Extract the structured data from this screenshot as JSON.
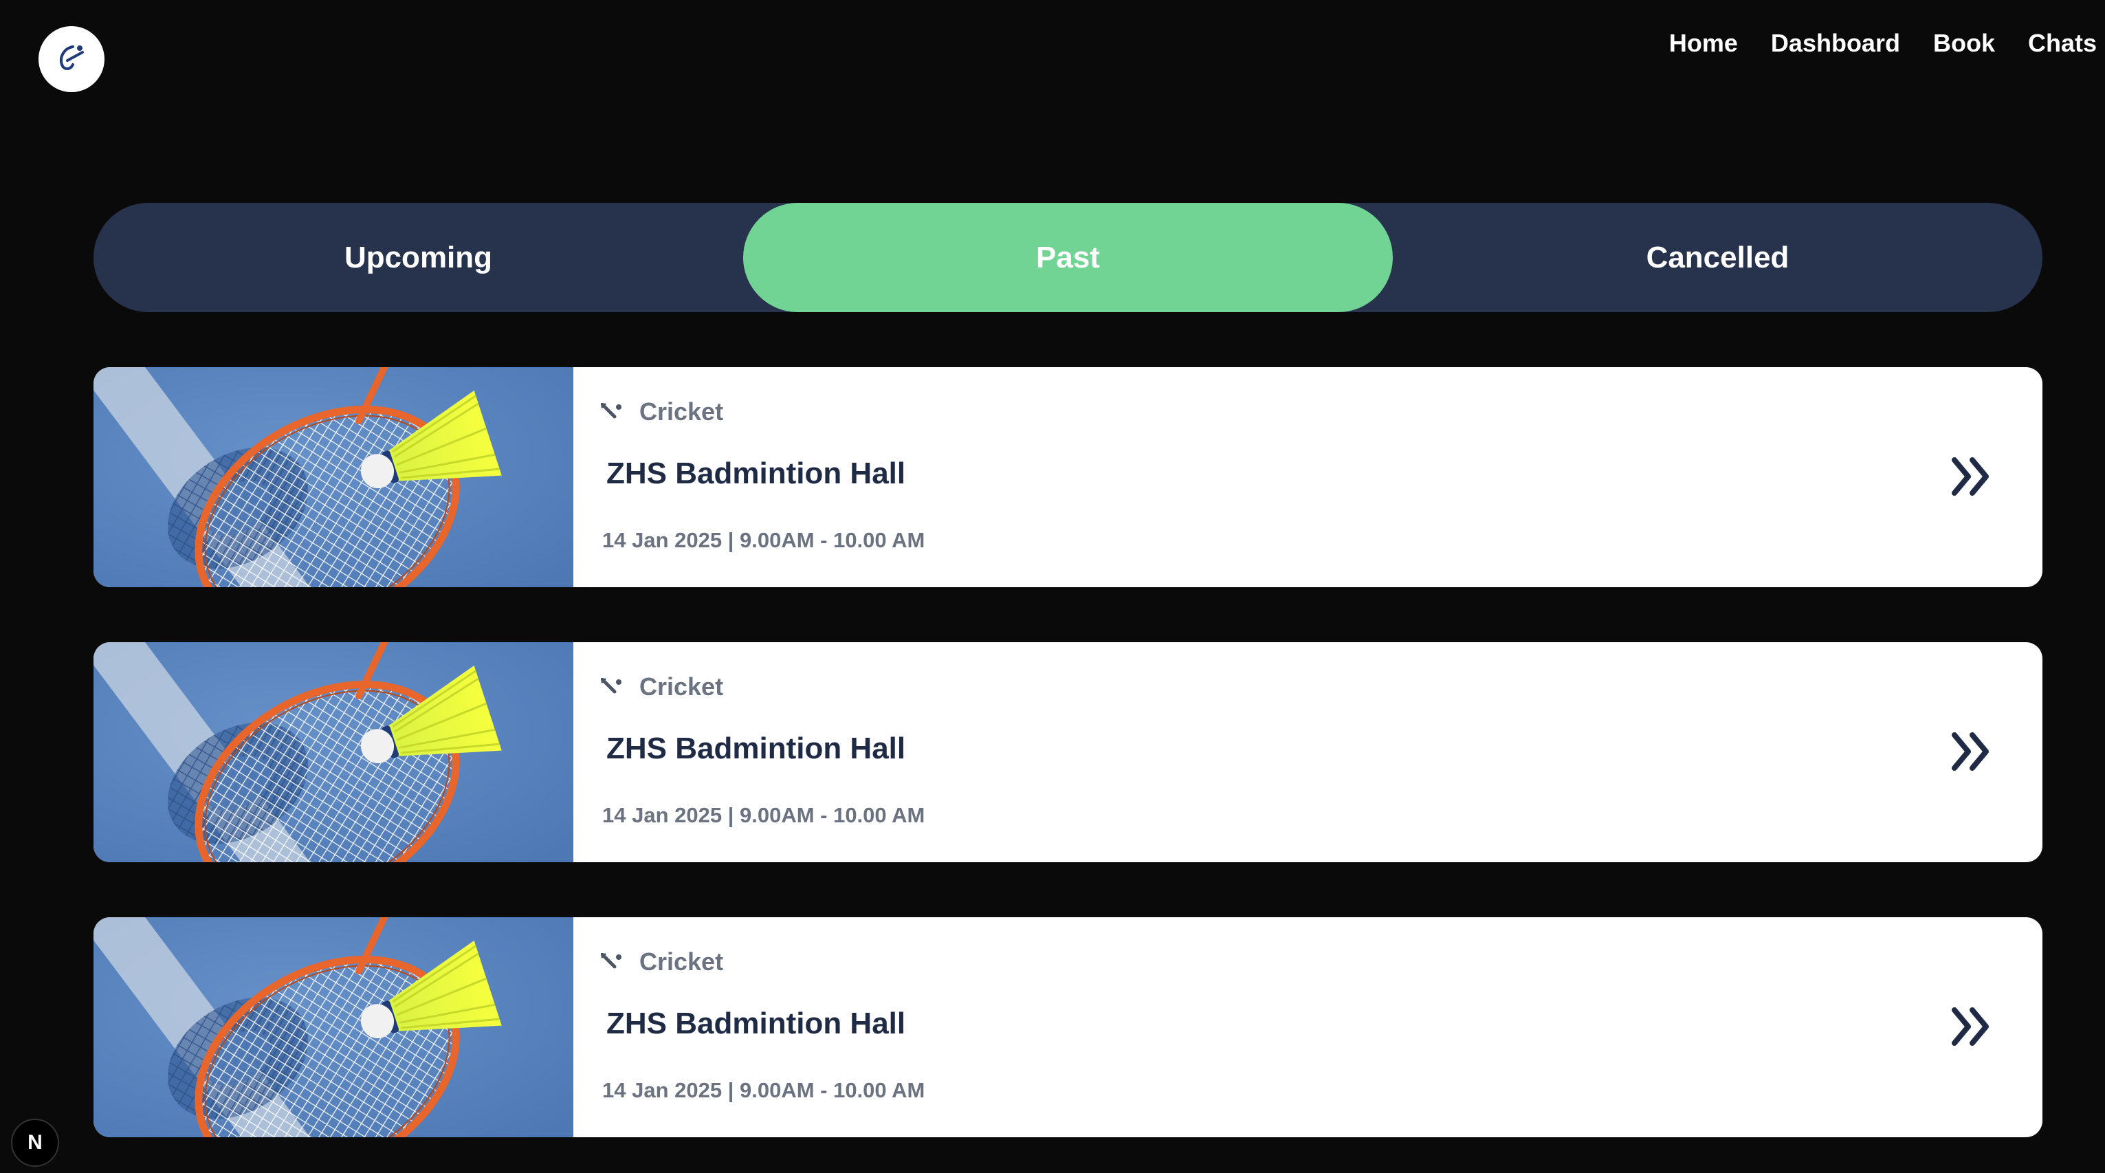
{
  "header": {
    "logo_icon": "brand-logo-icon",
    "nav": [
      {
        "label": "Home"
      },
      {
        "label": "Dashboard"
      },
      {
        "label": "Book"
      },
      {
        "label": "Chats"
      }
    ]
  },
  "tabs": [
    {
      "label": "Upcoming",
      "active": false
    },
    {
      "label": "Past",
      "active": true
    },
    {
      "label": "Cancelled",
      "active": false
    }
  ],
  "colors": {
    "background": "#0a0a0a",
    "tabbar": "#27334d",
    "active_tab": "#72d494",
    "card": "#ffffff",
    "title": "#1f2a44",
    "muted": "#6b7280"
  },
  "bookings": [
    {
      "sport": "Cricket",
      "sport_icon": "cricket-bat-icon",
      "venue": "ZHS Badmintion Hall",
      "datetime": "14 Jan 2025 | 9.00AM - 10.00 AM",
      "action_icon": "double-chevron-right-icon"
    },
    {
      "sport": "Cricket",
      "sport_icon": "cricket-bat-icon",
      "venue": "ZHS Badmintion Hall",
      "datetime": "14 Jan 2025 | 9.00AM - 10.00 AM",
      "action_icon": "double-chevron-right-icon"
    },
    {
      "sport": "Cricket",
      "sport_icon": "cricket-bat-icon",
      "venue": "ZHS Badmintion Hall",
      "datetime": "14 Jan 2025 | 9.00AM - 10.00 AM",
      "action_icon": "double-chevron-right-icon"
    }
  ],
  "dev_badge": {
    "label": "N"
  }
}
